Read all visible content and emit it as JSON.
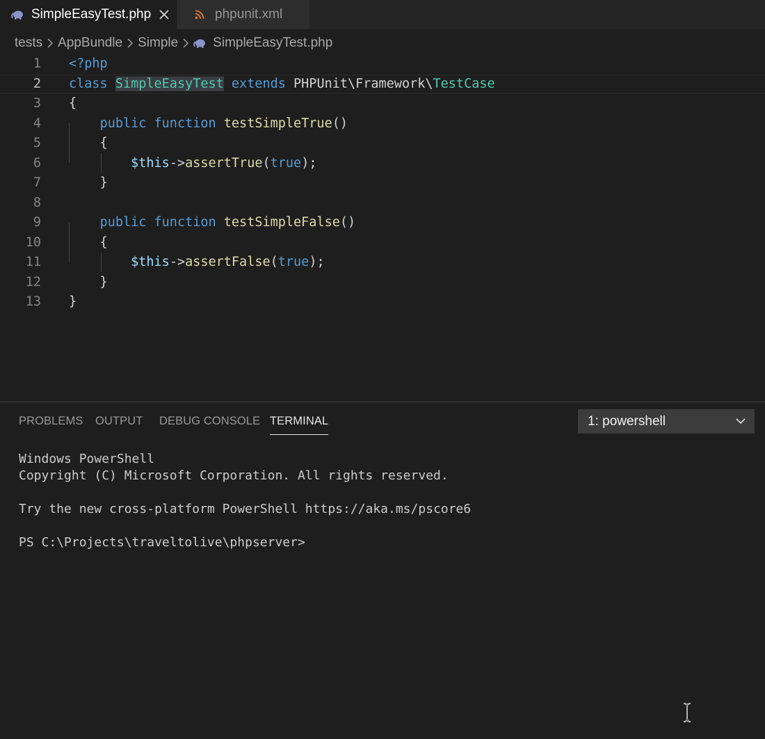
{
  "tabs": [
    {
      "label": "SimpleEasyTest.php",
      "icon": "php-elephant-icon",
      "active": true
    },
    {
      "label": "phpunit.xml",
      "icon": "rss-xml-icon",
      "active": false
    }
  ],
  "breadcrumb": {
    "items": [
      "tests",
      "AppBundle",
      "Simple",
      "SimpleEasyTest.php"
    ]
  },
  "editor": {
    "line_numbers": [
      "1",
      "2",
      "3",
      "4",
      "5",
      "6",
      "7",
      "8",
      "9",
      "10",
      "11",
      "12",
      "13"
    ],
    "lines": [
      [
        {
          "t": "<?php",
          "c": "kw"
        }
      ],
      [
        {
          "t": "class",
          "c": "kw"
        },
        {
          "t": " "
        },
        {
          "t": "SimpleEasyTest",
          "c": "cls hl-word"
        },
        {
          "t": " "
        },
        {
          "t": "extends",
          "c": "kw"
        },
        {
          "t": " PHPUnit\\Framework\\",
          "c": "plain"
        },
        {
          "t": "TestCase",
          "c": "cls"
        }
      ],
      [
        {
          "t": "{",
          "c": "plain"
        }
      ],
      [
        {
          "t": "    "
        },
        {
          "t": "public",
          "c": "kw"
        },
        {
          "t": " "
        },
        {
          "t": "function",
          "c": "kw"
        },
        {
          "t": " "
        },
        {
          "t": "testSimpleTrue",
          "c": "fn"
        },
        {
          "t": "()",
          "c": "plain"
        }
      ],
      [
        {
          "t": "    {",
          "c": "plain"
        }
      ],
      [
        {
          "t": "        "
        },
        {
          "t": "$this",
          "c": "var"
        },
        {
          "t": "->",
          "c": "plain"
        },
        {
          "t": "assertTrue",
          "c": "fn"
        },
        {
          "t": "(",
          "c": "plain"
        },
        {
          "t": "true",
          "c": "kw"
        },
        {
          "t": ");",
          "c": "plain"
        }
      ],
      [
        {
          "t": "    }",
          "c": "plain"
        }
      ],
      [],
      [
        {
          "t": "    "
        },
        {
          "t": "public",
          "c": "kw"
        },
        {
          "t": " "
        },
        {
          "t": "function",
          "c": "kw"
        },
        {
          "t": " "
        },
        {
          "t": "testSimpleFalse",
          "c": "fn"
        },
        {
          "t": "()",
          "c": "plain"
        }
      ],
      [
        {
          "t": "    {",
          "c": "plain"
        }
      ],
      [
        {
          "t": "        "
        },
        {
          "t": "$this",
          "c": "var"
        },
        {
          "t": "->",
          "c": "plain"
        },
        {
          "t": "assertFalse",
          "c": "fn"
        },
        {
          "t": "(",
          "c": "plain"
        },
        {
          "t": "true",
          "c": "kw"
        },
        {
          "t": ");",
          "c": "plain"
        }
      ],
      [
        {
          "t": "    }",
          "c": "plain"
        }
      ],
      [
        {
          "t": "}",
          "c": "plain"
        }
      ]
    ]
  },
  "panel": {
    "tabs": [
      "PROBLEMS",
      "OUTPUT",
      "DEBUG CONSOLE",
      "TERMINAL"
    ],
    "active_tab": "TERMINAL",
    "terminal_select": "1: powershell",
    "terminal_lines": [
      "Windows PowerShell",
      "Copyright (C) Microsoft Corporation. All rights reserved.",
      "",
      "Try the new cross-platform PowerShell https://aka.ms/pscore6",
      "",
      "PS C:\\Projects\\traveltolive\\phpserver>"
    ]
  },
  "colors": {
    "editor_bg": "#1e1e1e",
    "keyword": "#569cd6",
    "class": "#4ec9b0",
    "function": "#dcdcaa",
    "variable": "#9cdcfe"
  }
}
